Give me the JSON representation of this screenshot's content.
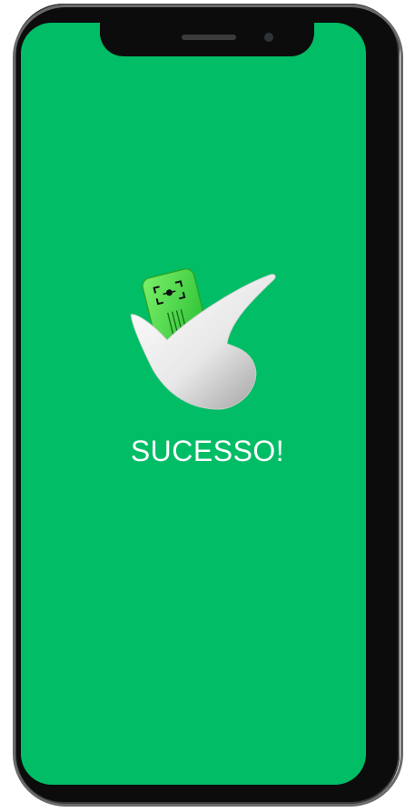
{
  "screen": {
    "background_color": "#00bd66",
    "title": "SUCESSO!"
  },
  "icons": {
    "main": "success-check-with-card-icon"
  }
}
